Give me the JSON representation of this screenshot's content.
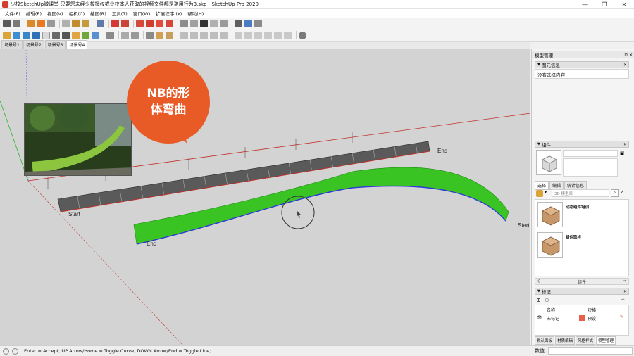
{
  "window": {
    "title": "少校SketchUp微课堂-只要您未经少校授权或少校本人获取的视频文件都是盗用行为3.skp - SketchUp Pro 2020",
    "minimize_glyph": "—",
    "maximize_glyph": "❐",
    "close_glyph": "✕"
  },
  "menu": [
    "文件(F)",
    "编辑(E)",
    "视图(V)",
    "相机(C)",
    "绘图(R)",
    "工具(T)",
    "窗口(W)",
    "扩展程序 (x)",
    "帮助(H)"
  ],
  "scene_tabs": [
    {
      "label": "场景号1",
      "active": false
    },
    {
      "label": "场景号2",
      "active": false
    },
    {
      "label": "场景号3",
      "active": false
    },
    {
      "label": "场景号4",
      "active": true
    }
  ],
  "viewport": {
    "callout_text": "NB的形\n体弯曲",
    "labels": {
      "end_top": "End",
      "start_left": "Start",
      "end_bottom": "End",
      "start_right": "Start"
    },
    "colors": {
      "callout": "#e85b26",
      "green_fence": "#33c21f",
      "gray_fence": "#4a4a4a",
      "red_axis": "#c2302a",
      "blue_curve": "#2d3ad8",
      "background": "#d3d3d3"
    }
  },
  "status_bar": {
    "hint": "Enter = Accept;  UP Arrow/Home = Toggle Curve;  DOWN Arrow/End = Toggle Line;",
    "measurements_label": "数值"
  },
  "tray": {
    "title": "模型管理",
    "entity_info": {
      "header": "图元信息",
      "message": "没有选择内容"
    },
    "components": {
      "header": "组件",
      "tabs": [
        {
          "label": "选择",
          "active": true
        },
        {
          "label": "编辑",
          "active": false
        },
        {
          "label": "统计信息",
          "active": false
        }
      ],
      "search_placeholder": "3D 模型库",
      "items": [
        {
          "name": "动态组件培训"
        },
        {
          "name": "组件取样"
        }
      ],
      "footer": "组件"
    },
    "tags": {
      "header": "标记",
      "columns": {
        "name": "名称",
        "pattern": "短横"
      },
      "rows": [
        {
          "name": "未标记",
          "color": "#e9604a",
          "pattern": "预设"
        }
      ]
    },
    "bottom_tabs": [
      {
        "label": "默认面板",
        "active": false
      },
      {
        "label": "材质编辑",
        "active": false
      },
      {
        "label": "风格样式",
        "active": false
      },
      {
        "label": "模型管理",
        "active": true
      }
    ]
  }
}
